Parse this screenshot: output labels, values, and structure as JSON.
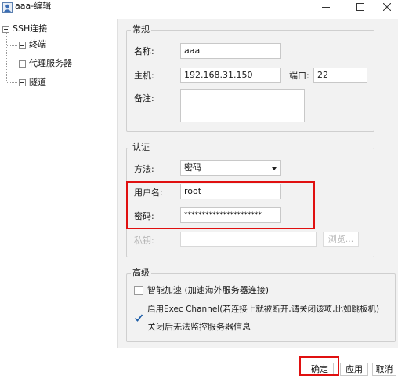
{
  "window": {
    "title": "aaa-编辑",
    "controls": {
      "minimize": "minimize-icon",
      "maximize": "maximize-icon",
      "close": "close-icon"
    }
  },
  "tree": {
    "root": {
      "label": "SSH连接",
      "icon": "collapse-icon"
    },
    "children": [
      {
        "label": "终端",
        "icon": "collapse-icon"
      },
      {
        "label": "代理服务器",
        "icon": "collapse-icon"
      },
      {
        "label": "隧道",
        "icon": "collapse-icon"
      }
    ]
  },
  "general": {
    "legend": "常规",
    "name_label": "名称:",
    "name_value": "aaa",
    "host_label": "主机:",
    "host_value": "192.168.31.150",
    "port_label": "端口:",
    "port_value": "22",
    "note_label": "备注:",
    "note_value": ""
  },
  "auth": {
    "legend": "认证",
    "method_label": "方法:",
    "method_value": "密码",
    "user_label": "用户名:",
    "user_value": "root",
    "password_label": "密码:",
    "password_value": "**********************",
    "key_label": "私钥:",
    "key_value": "",
    "browse_label": "浏览..."
  },
  "advanced": {
    "legend": "高级",
    "smart_accel_label": "智能加速 (加速海外服务器连接)",
    "smart_accel_checked": false,
    "exec_channel_label": "启用Exec Channel(若连接上就被断开,请关闭该项,比如跳板机)",
    "exec_channel_checked": true,
    "exec_channel_note": "关闭后无法监控服务器信息"
  },
  "buttons": {
    "ok": "确定",
    "apply": "应用",
    "cancel": "取消"
  },
  "colors": {
    "highlight_box": "#e01010",
    "panel_bg": "#f2f2f2",
    "check_mark": "#1f5fa8"
  }
}
